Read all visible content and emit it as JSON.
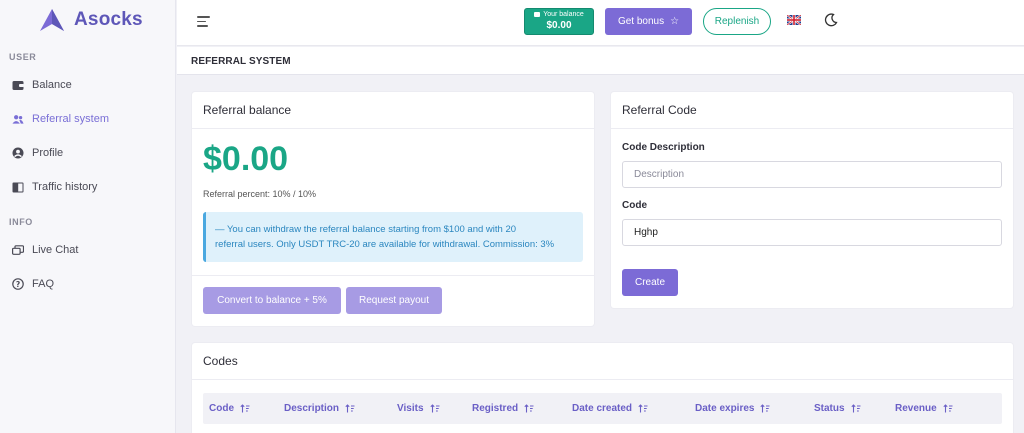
{
  "app": {
    "name": "Asocks"
  },
  "sidebar": {
    "sections": [
      {
        "label": "USER"
      },
      {
        "label": "INFO"
      }
    ],
    "items": [
      {
        "label": "Balance",
        "icon": "wallet-icon"
      },
      {
        "label": "Referral system",
        "icon": "users-icon",
        "active": true
      },
      {
        "label": "Profile",
        "icon": "user-circle-icon"
      },
      {
        "label": "Traffic history",
        "icon": "book-icon"
      },
      {
        "label": "Live Chat",
        "icon": "chat-icon"
      },
      {
        "label": "FAQ",
        "icon": "question-circle-icon"
      }
    ]
  },
  "header": {
    "balance_label": "Your balance",
    "balance_value": "$0.00",
    "bonus_label": "Get bonus",
    "replenish_label": "Replenish"
  },
  "page": {
    "title": "REFERRAL SYSTEM"
  },
  "referral_balance": {
    "title": "Referral balance",
    "amount": "$0.00",
    "percent_text": "Referral percent: 10% / 10%",
    "info_line1": "— You can withdraw the referral balance starting from $100 and with 20",
    "info_line2": "referral users. Only USDT TRC-20 are available for withdrawal. Commission: 3%",
    "convert_label": "Convert to balance + 5%",
    "payout_label": "Request payout"
  },
  "referral_code": {
    "title": "Referral Code",
    "desc_label": "Code Description",
    "desc_placeholder": "Description",
    "code_label": "Code",
    "code_value": "Hghp",
    "create_label": "Create"
  },
  "codes": {
    "title": "Codes",
    "columns": [
      "Code",
      "Description",
      "Visits",
      "Registred",
      "Date created",
      "Date expires",
      "Status",
      "Revenue"
    ]
  },
  "colors": {
    "accent": "#7c6bd6",
    "green": "#1aa686",
    "info_bg": "#dff1fb"
  }
}
